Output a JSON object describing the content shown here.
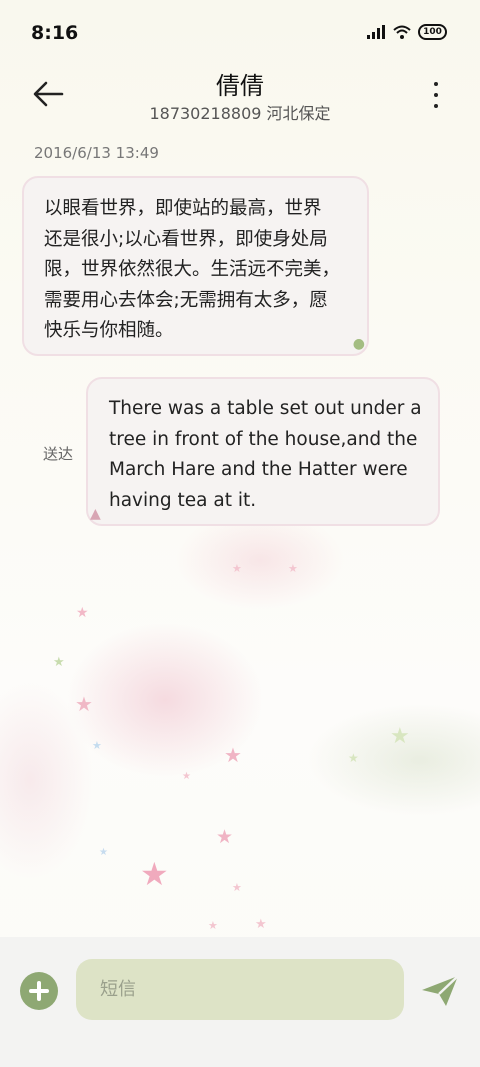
{
  "status_bar": {
    "time": "8:16",
    "battery": "100",
    "icons": [
      "signal-icon",
      "wifi-icon",
      "battery-icon"
    ]
  },
  "header": {
    "back_icon": "arrow-left-icon",
    "contact_name": "倩倩",
    "contact_info": "18730218809 河北保定",
    "more_icon": "more-vertical-icon"
  },
  "conversation": {
    "date": "2016/6/13 13:49",
    "received": {
      "lines": [
        "以眼看世界，即使站的最高，世界",
        "还是很小;以心看世界，即使身处局",
        "限，世界依然很大。生活远不完美，",
        "需要用心去体会;无需拥有太多，愿",
        "快乐与你相随。"
      ]
    },
    "sent": {
      "lines": [
        "There was a table set out under a",
        "tree in front of the house,and the",
        "March Hare and the Hatter were",
        "having tea at it."
      ],
      "status": "送达"
    }
  },
  "input_bar": {
    "add_icon": "plus-circle-icon",
    "placeholder": "短信",
    "send_icon": "send-icon"
  },
  "colors": {
    "accent": "#8ea873",
    "input_bg": "#dde3c6",
    "bubble_border": "#f0dfe4"
  }
}
